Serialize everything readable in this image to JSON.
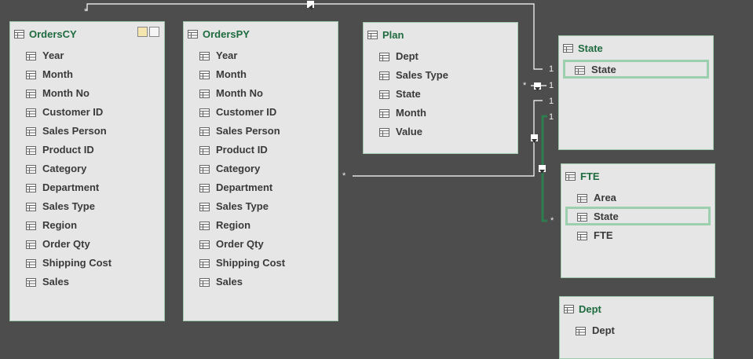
{
  "tables": {
    "orderscy": {
      "title": "OrdersCY",
      "fields": [
        "Year",
        "Month",
        "Month No",
        "Customer ID",
        "Sales Person",
        "Product ID",
        "Category",
        "Department",
        "Sales Type",
        "Region",
        "Order Qty",
        "Shipping Cost",
        "Sales"
      ]
    },
    "orderspy": {
      "title": "OrdersPY",
      "fields": [
        "Year",
        "Month",
        "Month No",
        "Customer ID",
        "Sales Person",
        "Product ID",
        "Category",
        "Department",
        "Sales Type",
        "Region",
        "Order Qty",
        "Shipping Cost",
        "Sales"
      ]
    },
    "plan": {
      "title": "Plan",
      "fields": [
        "Dept",
        "Sales Type",
        "State",
        "Month",
        "Value"
      ]
    },
    "state": {
      "title": "State",
      "fields": [
        "State"
      ]
    },
    "fte": {
      "title": "FTE",
      "fields": [
        "Area",
        "State",
        "FTE"
      ]
    },
    "dept": {
      "title": "Dept",
      "fields": [
        "Dept"
      ]
    }
  },
  "cardinality": {
    "many": "*",
    "one": "1"
  },
  "colors": {
    "background": "#4d4d4d",
    "table_bg": "#e6e6e6",
    "table_border": "#9fc9ad",
    "title": "#1e6b3f",
    "selected_outline": "#9ccfae",
    "active_link": "#2e7d4f"
  },
  "icons": {
    "table": "table-icon",
    "header_btn_1": "hierarchy-icon",
    "header_btn_2": "expand-icon"
  }
}
